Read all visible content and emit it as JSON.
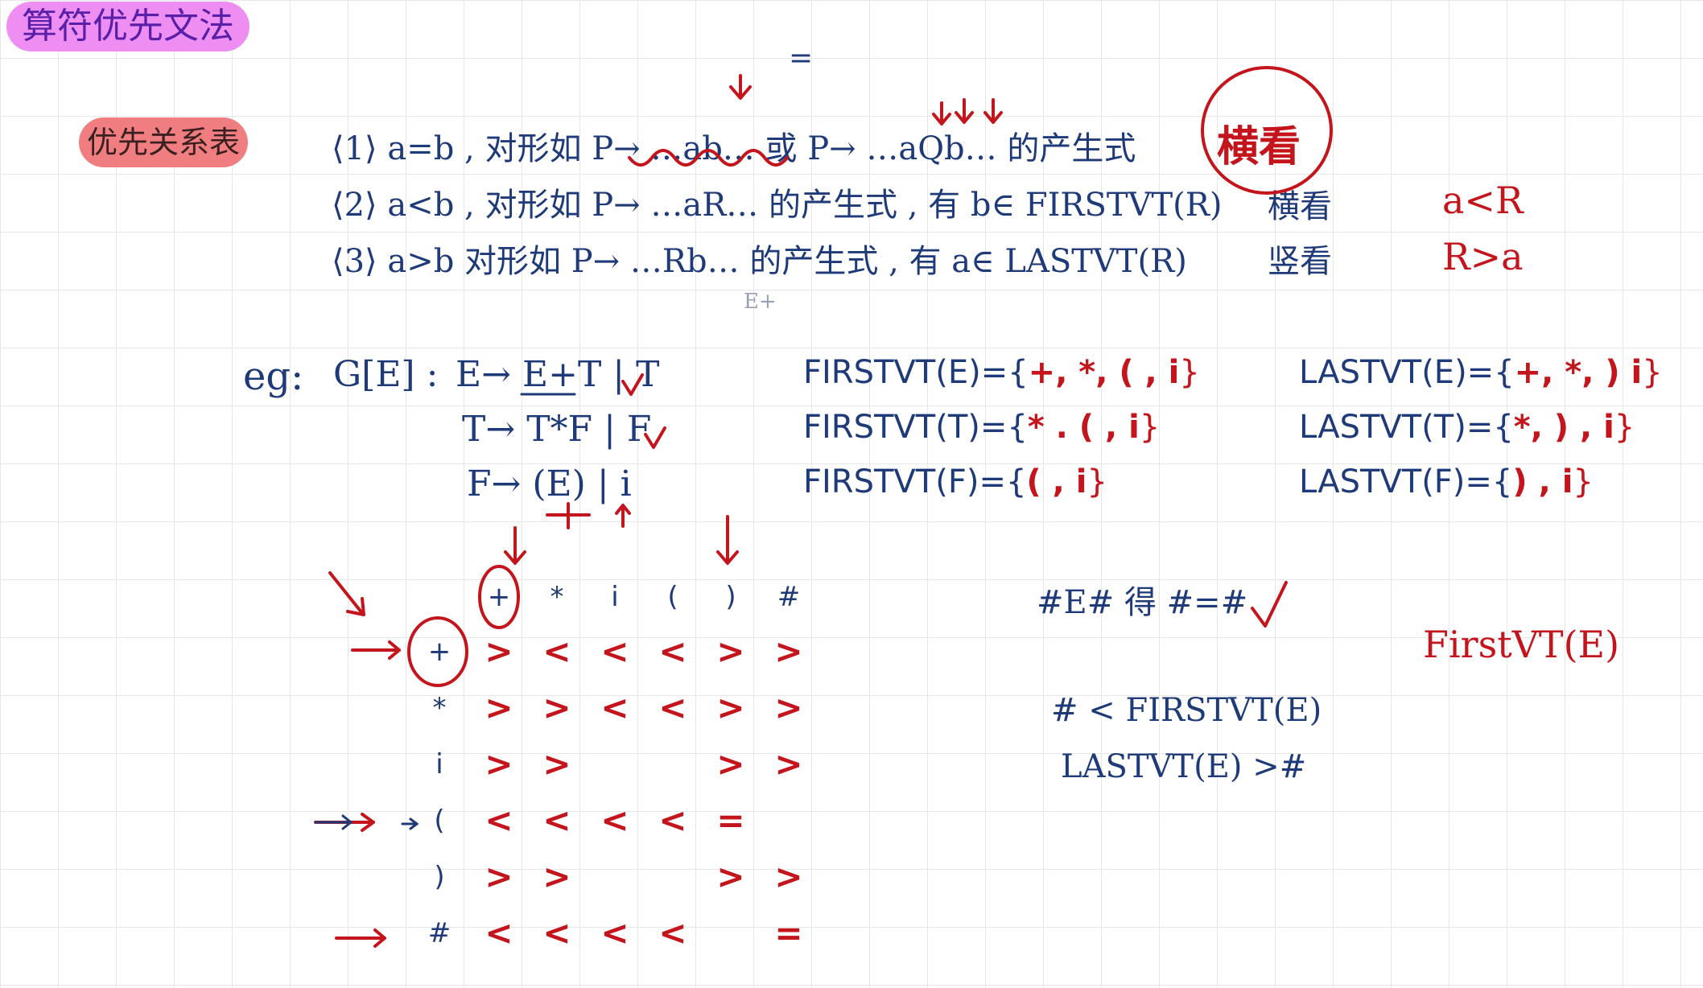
{
  "title": "算符优先文法",
  "section_tag": "优先关系表",
  "rules": [
    {
      "text": "⟨1⟩ a=b , 对形如 P→ …ab… 或 P→ …aQb… 的产生式"
    },
    {
      "text": "⟨2⟩ a<b , 对形如 P→ …aR… 的产生式 , 有 b∈ FIRSTVT(R)"
    },
    {
      "text": "⟨3⟩ a>b  对形如 P→ …Rb… 的产生式 , 有 a∈ LASTVT(R)"
    }
  ],
  "notes": {
    "above_equals": "=",
    "heng_kan_big": "横看",
    "heng_kan": "横看",
    "shu_kan": "竖看",
    "a_lt_R": "a<R",
    "R_gt_a": "R>a",
    "e_plus": "E+"
  },
  "grammar": {
    "eg": "eg:",
    "g": "G[E] :",
    "p1": "E→ E+T | T",
    "p2": "T→ T*F | F",
    "p3": "F→ (E) | i"
  },
  "firstvt": {
    "e_label": "FIRSTVT(E)={",
    "e_vals": "+, *, ( , i",
    "e_close": "}",
    "t_label": "FIRSTVT(T)={",
    "t_vals": "* . ( , i",
    "t_close": "}",
    "f_label": "FIRSTVT(F)={",
    "f_vals": "( , i",
    "f_close": "}"
  },
  "lastvt": {
    "e_label": "LASTVT(E)={",
    "e_vals": "+, *, ) i",
    "e_close": "}",
    "t_label": "LASTVT(T)={",
    "t_vals": "*, ) , i",
    "t_close": "}",
    "f_label": "LASTVT(F)={",
    "f_vals": ") , i",
    "f_close": "}"
  },
  "table": {
    "headers": [
      "+",
      "*",
      "i",
      "(",
      ")",
      "#"
    ],
    "rows": [
      {
        "label": "+",
        "cells": [
          ">",
          "<",
          "<",
          "<",
          ">",
          ">"
        ]
      },
      {
        "label": "*",
        "cells": [
          ">",
          ">",
          "<",
          "<",
          ">",
          ">"
        ]
      },
      {
        "label": "i",
        "cells": [
          ">",
          ">",
          "",
          "",
          ">",
          ">"
        ]
      },
      {
        "label": "(",
        "cells": [
          "<",
          "<",
          "<",
          "<",
          "=",
          ""
        ]
      },
      {
        "label": ")",
        "cells": [
          ">",
          ">",
          "",
          "",
          ">",
          ">"
        ]
      },
      {
        "label": "#",
        "cells": [
          "<",
          "<",
          "<",
          "<",
          "",
          "="
        ]
      }
    ]
  },
  "right_notes": {
    "hash_eq": "#E# 得 #=#",
    "firstvt_e": "FirstVT(E)",
    "hash_lt": "# < FIRSTVT(E)",
    "lastvt_gt": "LASTVT(E) >#"
  },
  "colors": {
    "ink_blue": "#1f3a78",
    "ink_red": "#c4141c",
    "title_bg": "#ee8ef2",
    "tag_bg": "#f07e80"
  }
}
